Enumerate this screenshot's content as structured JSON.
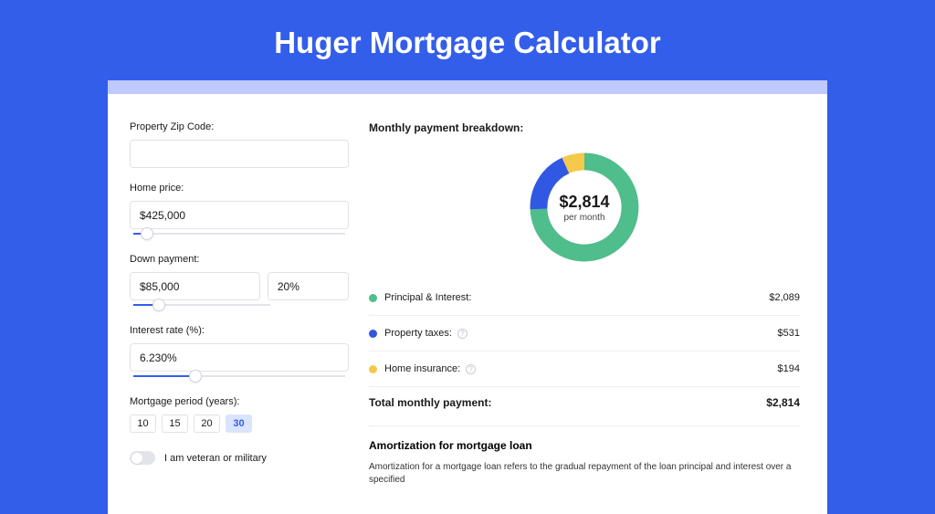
{
  "page_title": "Huger Mortgage Calculator",
  "form": {
    "zip": {
      "label": "Property Zip Code:",
      "value": ""
    },
    "home_price": {
      "label": "Home price:",
      "value": "$425,000",
      "slider_pct": 8
    },
    "down_payment": {
      "label": "Down payment:",
      "amount": "$85,000",
      "pct": "20%",
      "slider_pct": 20
    },
    "interest_rate": {
      "label": "Interest rate (%):",
      "value": "6.230%",
      "slider_pct": 30
    },
    "period": {
      "label": "Mortgage period (years):",
      "options": [
        "10",
        "15",
        "20",
        "30"
      ],
      "selected": "30"
    },
    "veteran": {
      "label": "I am veteran or military",
      "on": false
    }
  },
  "breakdown": {
    "title": "Monthly payment breakdown:",
    "center_amount": "$2,814",
    "center_sub": "per month",
    "items": [
      {
        "label": "Principal & Interest:",
        "value": "$2,089",
        "color": "#4fbd8c",
        "info": false
      },
      {
        "label": "Property taxes:",
        "value": "$531",
        "color": "#3158e2",
        "info": true
      },
      {
        "label": "Home insurance:",
        "value": "$194",
        "color": "#f4c94c",
        "info": true
      }
    ],
    "total_label": "Total monthly payment:",
    "total_value": "$2,814"
  },
  "amortization": {
    "title": "Amortization for mortgage loan",
    "body": "Amortization for a mortgage loan refers to the gradual repayment of the loan principal and interest over a specified"
  },
  "chart_data": {
    "type": "pie",
    "title": "Monthly payment breakdown",
    "series": [
      {
        "name": "Principal & Interest",
        "value": 2089,
        "color": "#4fbd8c"
      },
      {
        "name": "Property taxes",
        "value": 531,
        "color": "#3158e2"
      },
      {
        "name": "Home insurance",
        "value": 194,
        "color": "#f4c94c"
      }
    ],
    "total": 2814,
    "center_label": "$2,814 per month"
  }
}
